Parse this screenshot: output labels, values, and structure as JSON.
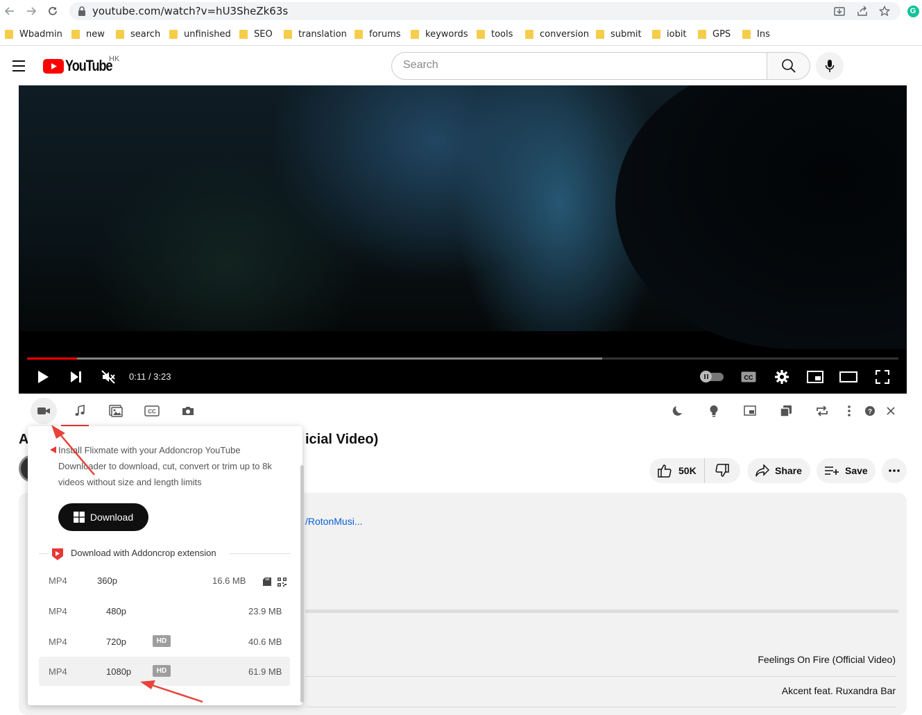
{
  "browser": {
    "url": "youtube.com/watch?v=hU3SheZk63s",
    "bookmarks": [
      "Wbadmin",
      "new",
      "search",
      "unfinished",
      "SEO",
      "translation",
      "forums",
      "keywords",
      "tools",
      "conversion",
      "submit",
      "iobit",
      "GPS",
      "Ins"
    ]
  },
  "youtube": {
    "logo_text": "YouTube",
    "region": "HK",
    "search_placeholder": "Search"
  },
  "player": {
    "time": "0:11 / 3:23",
    "progress_played": 0.057,
    "progress_loaded": 0.66
  },
  "video": {
    "title_first_letter": "A",
    "title_fragment": "icial Video)",
    "likes": "50K",
    "share_label": "Share",
    "save_label": "Save",
    "desc_link": "/RotonMusi...",
    "music_title": "Feelings On Fire (Official Video)",
    "music_artist": "Akcent feat. Ruxandra Bar"
  },
  "popup": {
    "install_text": "Install Flixmate with your Addoncrop YouTube Downloader to download, cut, convert or trim up to 8k videos without size and length limits",
    "download_label": "Download",
    "extension_heading": "Download with Addoncrop extension",
    "formats": [
      {
        "type": "MP4",
        "res": "360p",
        "size": "16.6 MB",
        "hd": ""
      },
      {
        "type": "MP4",
        "res": "480p",
        "size": "23.9 MB",
        "hd": ""
      },
      {
        "type": "MP4",
        "res": "720p",
        "size": "40.6 MB",
        "hd": "HD"
      },
      {
        "type": "MP4",
        "res": "1080p",
        "size": "61.9 MB",
        "hd": "HD"
      }
    ]
  },
  "colors": {
    "youtube_red": "#ff0000",
    "annotation_arrow": "#e8433a",
    "progress_red": "#ff0000"
  }
}
